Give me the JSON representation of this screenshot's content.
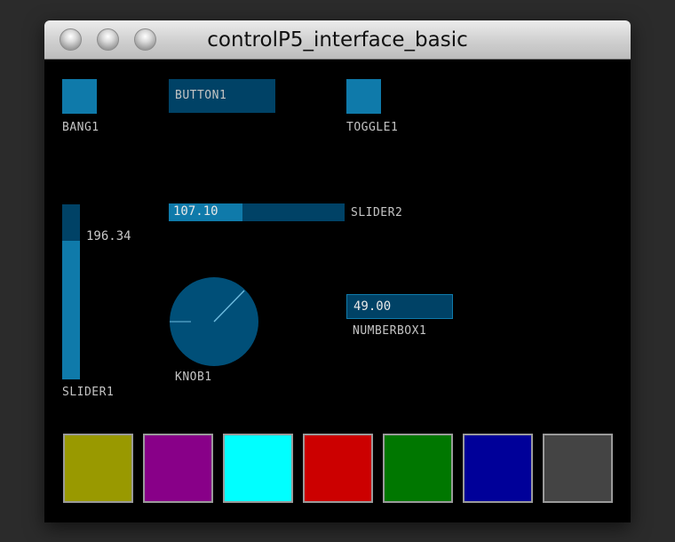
{
  "window": {
    "title": "controlP5_interface_basic",
    "buttons": [
      "close",
      "minimize",
      "zoom"
    ]
  },
  "colors": {
    "active": "#0f7aaa",
    "background": "#004266",
    "foreground": "#00729f",
    "label": "#c4c4c4",
    "canvas": "#000000"
  },
  "controls": {
    "bang1": {
      "label": "BANG1"
    },
    "button1": {
      "label": "BUTTON1"
    },
    "toggle1": {
      "label": "TOGGLE1"
    },
    "slider1": {
      "label": "SLIDER1",
      "value": "196.34",
      "fraction": 0.79
    },
    "slider2": {
      "label": "SLIDER2",
      "value": "107.10",
      "fraction": 0.42
    },
    "knob1": {
      "label": "KNOB1"
    },
    "numberbox1": {
      "label": "NUMBERBOX1",
      "value": "49.00"
    }
  },
  "swatches": [
    {
      "name": "olive",
      "color": "#999900"
    },
    {
      "name": "purple",
      "color": "#880088"
    },
    {
      "name": "cyan",
      "color": "#00ffff"
    },
    {
      "name": "red",
      "color": "#cc0000"
    },
    {
      "name": "green",
      "color": "#007700"
    },
    {
      "name": "blue",
      "color": "#000099"
    },
    {
      "name": "gray",
      "color": "#444444"
    }
  ]
}
